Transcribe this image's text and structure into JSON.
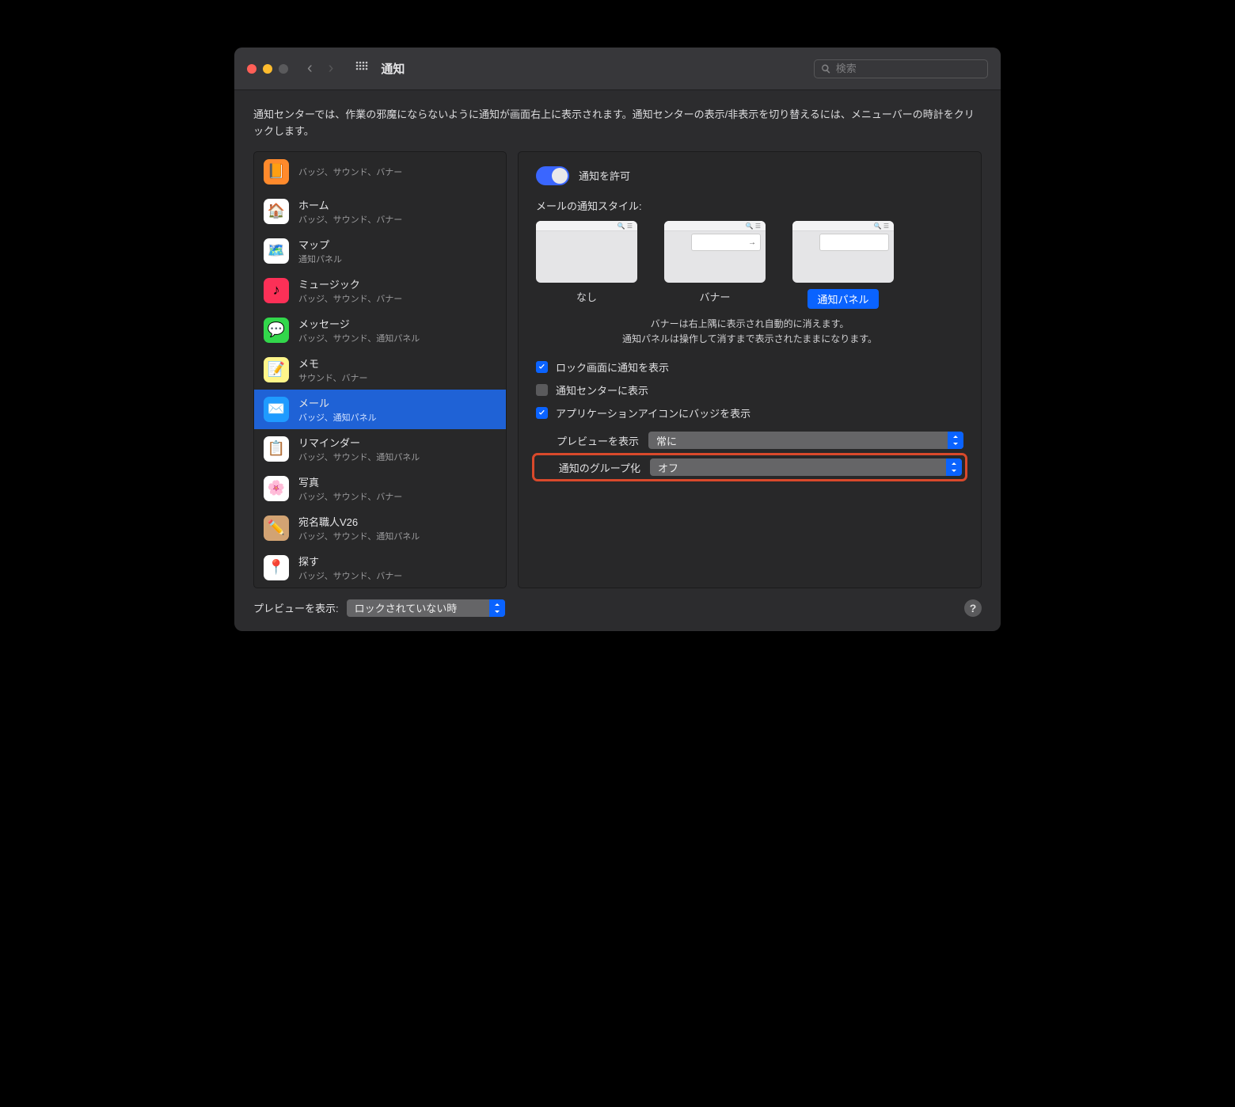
{
  "toolbar": {
    "title": "通知",
    "search_placeholder": "検索"
  },
  "intro": "通知センターでは、作業の邪魔にならないように通知が画面右上に表示されます。通知センターの表示/非表示を切り替えるには、メニューバーの時計をクリックします。",
  "sidebar": {
    "items": [
      {
        "name": "",
        "sub": "バッジ、サウンド、バナー",
        "icon_bg": "#ff8a2c",
        "glyph": "📙"
      },
      {
        "name": "ホーム",
        "sub": "バッジ、サウンド、バナー",
        "icon_bg": "#ffffff",
        "glyph": "🏠"
      },
      {
        "name": "マップ",
        "sub": "通知パネル",
        "icon_bg": "#ffffff",
        "glyph": "🗺️"
      },
      {
        "name": "ミュージック",
        "sub": "バッジ、サウンド、バナー",
        "icon_bg": "#fc3057",
        "glyph": "♪"
      },
      {
        "name": "メッセージ",
        "sub": "バッジ、サウンド、通知パネル",
        "icon_bg": "#32d74b",
        "glyph": "💬"
      },
      {
        "name": "メモ",
        "sub": "サウンド、バナー",
        "icon_bg": "#fff68a",
        "glyph": "📝"
      },
      {
        "name": "メール",
        "sub": "バッジ、通知パネル",
        "icon_bg": "#1f9bff",
        "glyph": "✉️"
      },
      {
        "name": "リマインダー",
        "sub": "バッジ、サウンド、通知パネル",
        "icon_bg": "#ffffff",
        "glyph": "📋"
      },
      {
        "name": "写真",
        "sub": "バッジ、サウンド、バナー",
        "icon_bg": "#ffffff",
        "glyph": "🌸"
      },
      {
        "name": "宛名職人V26",
        "sub": "バッジ、サウンド、通知パネル",
        "icon_bg": "#d2a373",
        "glyph": "✏️"
      },
      {
        "name": "探す",
        "sub": "バッジ、サウンド、バナー",
        "icon_bg": "#ffffff",
        "glyph": "📍"
      }
    ],
    "selected_index": 6
  },
  "detail": {
    "allow_label": "通知を許可",
    "allow_on": true,
    "style_title": "メールの通知スタイル:",
    "styles": [
      "なし",
      "バナー",
      "通知パネル"
    ],
    "selected_style": 2,
    "hint_line1": "バナーは右上隅に表示され自動的に消えます。",
    "hint_line2": "通知パネルは操作して消すまで表示されたままになります。",
    "checks": [
      {
        "label": "ロック画面に通知を表示",
        "on": true
      },
      {
        "label": "通知センターに表示",
        "on": false
      },
      {
        "label": "アプリケーションアイコンにバッジを表示",
        "on": true
      }
    ],
    "preview_label": "プレビューを表示",
    "preview_value": "常に",
    "group_label": "通知のグループ化",
    "group_value": "オフ"
  },
  "footer": {
    "preview_label": "プレビューを表示:",
    "preview_value": "ロックされていない時"
  }
}
